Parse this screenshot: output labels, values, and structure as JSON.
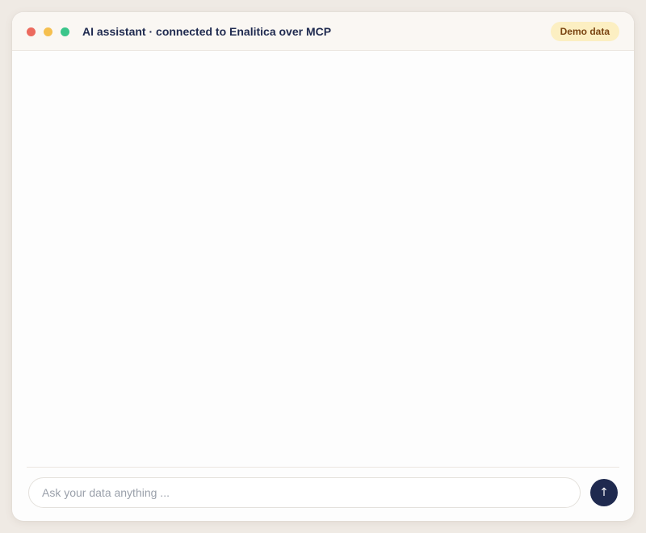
{
  "window": {
    "title": "AI assistant · connected to Enalitica over MCP",
    "badge": "Demo data",
    "controls": {
      "close_color": "#ec6a5e",
      "minimize_color": "#f5bf4f",
      "maximize_color": "#3ac58a"
    }
  },
  "composer": {
    "placeholder": "Ask your data anything ...",
    "value": "",
    "send_icon": "↑",
    "send_icon_name": "arrow-up-icon"
  },
  "colors": {
    "accent": "#1f2a4f",
    "badge_bg": "#fcefc2",
    "badge_text": "#7a4512"
  }
}
